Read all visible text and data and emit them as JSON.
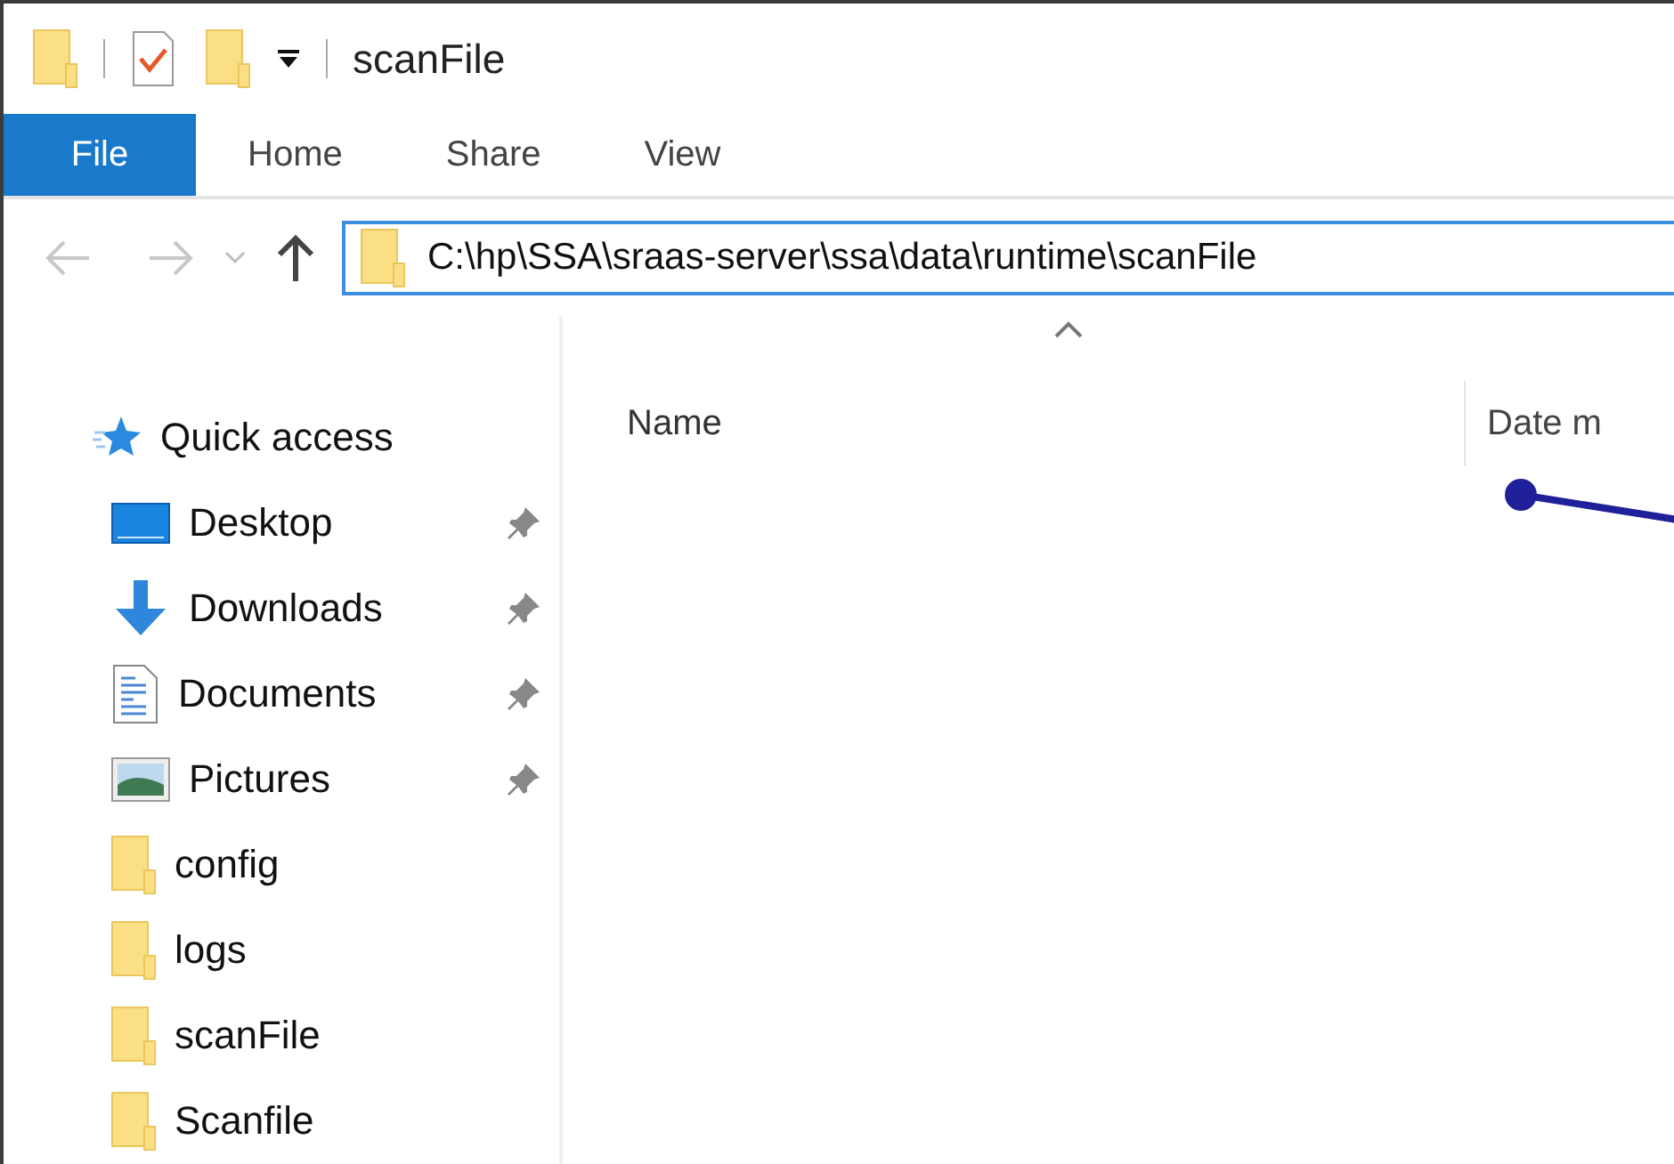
{
  "window": {
    "title": "scanFile"
  },
  "ribbon": {
    "tabs": [
      {
        "label": "File",
        "selected": true
      },
      {
        "label": "Home",
        "selected": false
      },
      {
        "label": "Share",
        "selected": false
      },
      {
        "label": "View",
        "selected": false
      }
    ]
  },
  "navigation": {
    "back": {
      "disabled": true
    },
    "forward": {
      "disabled": true
    },
    "up": {
      "disabled": false
    },
    "address": {
      "value": "C:\\hp\\SSA\\sraas-server\\ssa\\data\\runtime\\scanFile"
    }
  },
  "sidebar": {
    "items": [
      {
        "label": "Quick access",
        "kind": "star",
        "children": [
          {
            "label": "Desktop",
            "kind": "desktop",
            "pinned": true
          },
          {
            "label": "Downloads",
            "kind": "download",
            "pinned": true
          },
          {
            "label": "Documents",
            "kind": "document",
            "pinned": true
          },
          {
            "label": "Pictures",
            "kind": "pictures",
            "pinned": true
          },
          {
            "label": "config",
            "kind": "folder",
            "pinned": false
          },
          {
            "label": "logs",
            "kind": "folder",
            "pinned": false
          },
          {
            "label": "scanFile",
            "kind": "folder",
            "pinned": false
          },
          {
            "label": "Scanfile",
            "kind": "folder",
            "pinned": false
          }
        ]
      }
    ]
  },
  "file_list": {
    "columns": [
      {
        "label": "Name",
        "sorted": true
      },
      {
        "label": "Date m",
        "sorted": false
      }
    ]
  }
}
